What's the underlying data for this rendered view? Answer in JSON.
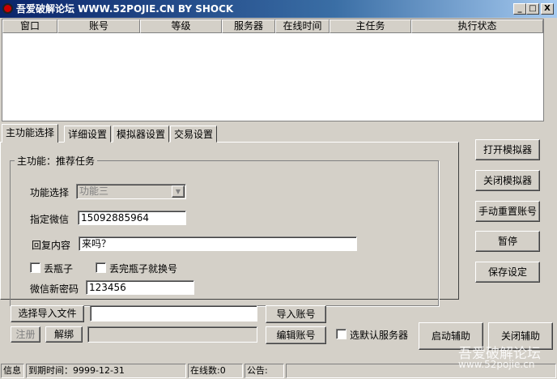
{
  "window": {
    "title": "吾爱破解论坛 WWW.52POJIE.CN BY SHOCK",
    "min": "_",
    "max": "□",
    "close": "X"
  },
  "table": {
    "columns": [
      "窗口",
      "账号",
      "等级",
      "服务器",
      "在线时间",
      "主任务",
      "执行状态"
    ]
  },
  "tabs": [
    "主功能选择",
    "详细设置",
    "模拟器设置",
    "交易设置"
  ],
  "group": {
    "title": "主功能：推荐任务",
    "function_label": "功能选择",
    "function_value": "功能三",
    "wechat_label": "指定微信",
    "wechat_value": "15092885964",
    "reply_label": "回复内容",
    "reply_value": "来吗？",
    "drop_bottle": "丢瓶子",
    "drop_switch": "丢完瓶子就换号",
    "newpwd_label": "微信新密码",
    "newpwd_value": "123456"
  },
  "side_buttons": [
    "打开模拟器",
    "关闭模拟器",
    "手动重置账号",
    "暂停",
    "保存设定"
  ],
  "bottom": {
    "select_file": "选择导入文件",
    "file_value": "",
    "import": "导入账号",
    "register": "注册",
    "unbind": "解绑",
    "edit": "编辑账号",
    "default_server": "选默认服务器",
    "start": "启动辅助",
    "stop": "关闭辅助"
  },
  "status": {
    "info": "信息",
    "expire": "到期时间：9999-12-31",
    "online": "在线数:0",
    "notice": "公告:"
  },
  "watermark": {
    "name": "吾爱破解论坛",
    "url": "www.52pojie.cn"
  }
}
